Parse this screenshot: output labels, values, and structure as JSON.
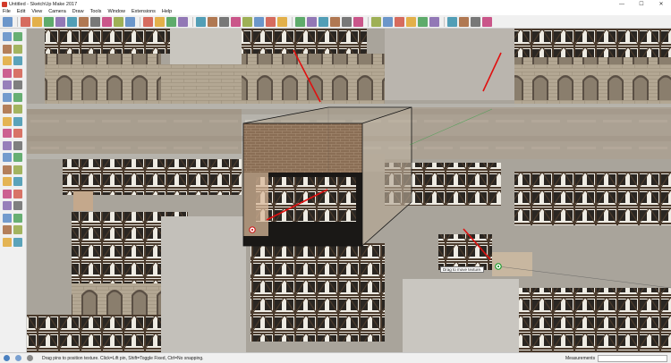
{
  "window": {
    "title": "Untitled - SketchUp Make 2017",
    "controls": [
      "—",
      "☐",
      "✕"
    ]
  },
  "menu": [
    "File",
    "Edit",
    "View",
    "Camera",
    "Draw",
    "Tools",
    "Window",
    "Extensions",
    "Help"
  ],
  "toolbar_icons": [
    "select-icon",
    "eraser-icon",
    "pencil-icon",
    "arc-icon",
    "rectangle-icon",
    "push-pull-icon",
    "move-icon",
    "rotate-icon",
    "tape-icon",
    "text-icon",
    "paint-icon",
    "orbit-icon",
    "pan-icon",
    "zoom-icon",
    "zoom-extents-icon",
    "warehouse-icon",
    "components-icon",
    "styles-icon",
    "layers-icon",
    "scenes-icon",
    "shadows-icon",
    "fog-icon",
    "section-icon",
    "iso-view-icon",
    "top-view-icon",
    "front-view-icon",
    "right-view-icon",
    "back-view-icon",
    "left-view-icon",
    "xray-icon",
    "wireframe-icon",
    "hidden-line-icon",
    "shaded-icon",
    "textured-icon",
    "monochrome-icon",
    "extension-warehouse-icon",
    "send-to-layout-icon",
    "ruby-console-icon",
    "export-icon"
  ],
  "left_toolbar_icons": [
    "select-icon",
    "component-icon",
    "paint-bucket-icon",
    "eraser-icon",
    "line-icon",
    "freehand-icon",
    "rectangle-icon",
    "rotated-rect-icon",
    "circle-icon",
    "polygon-icon",
    "arc-icon",
    "pie-icon",
    "move-icon",
    "push-pull-icon",
    "rotate-icon",
    "follow-me-icon",
    "scale-icon",
    "offset-icon",
    "tape-measure-icon",
    "dimension-icon",
    "protractor-icon",
    "text-icon",
    "axes-icon",
    "3d-text-icon",
    "orbit-icon",
    "pan-icon",
    "zoom-icon",
    "zoom-window-icon",
    "zoom-extents-icon",
    "previous-view-icon",
    "position-camera-icon",
    "look-around-icon",
    "walk-icon",
    "section-plane-icon",
    "footprint-icon",
    "glasses-icon"
  ],
  "tooltip": "Drag to move texture.",
  "status": {
    "hint": "Drag pins to position texture.  Click=Lift pin, Shift=Toggle Fixed, Ctrl=No snapping.",
    "measurements_label": "Measurements",
    "measurements_value": ""
  },
  "colors": {
    "accent_red": "#e01010",
    "pin_green": "#1a9a2a",
    "pin_red": "#d02020",
    "box_edge": "#141414"
  }
}
